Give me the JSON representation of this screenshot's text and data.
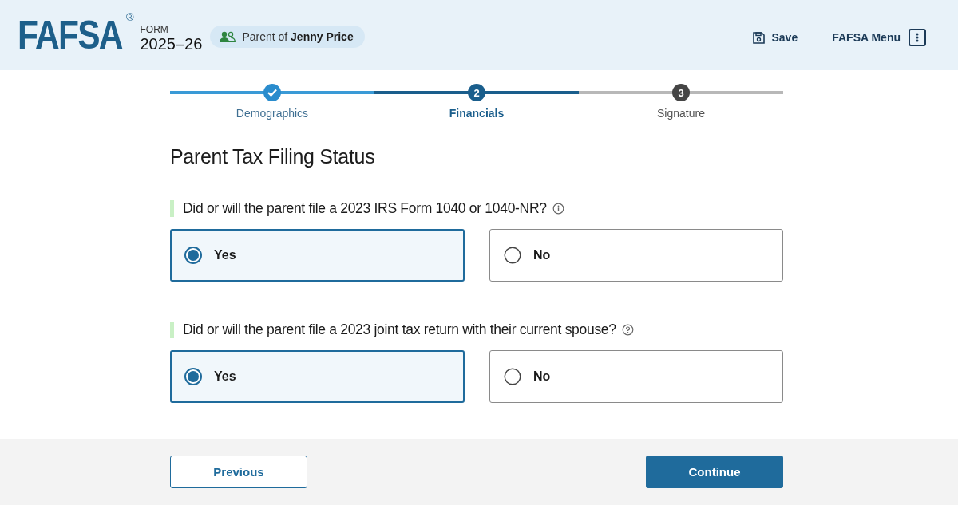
{
  "header": {
    "logo": "FAFSA",
    "logo_mark": "®",
    "form_label": "FORM",
    "form_year": "2025–26",
    "role_badge": "Parent of **Jenny Price**",
    "save": "Save",
    "menu": "FAFSA Menu"
  },
  "steps": [
    {
      "label": "Demographics",
      "kind": "complete"
    },
    {
      "label": "Financials",
      "kind": "current",
      "number": "2"
    },
    {
      "label": "Signature",
      "kind": "upcoming",
      "number": "3"
    }
  ],
  "page_title": "Parent Tax Filing Status",
  "questions": [
    {
      "text": "Did or will the parent file a 2023 IRS Form 1040 or 1040-NR?",
      "kind": "info",
      "options": [
        {
          "label": "Yes",
          "selected": true
        },
        {
          "label": "No",
          "selected": false
        }
      ]
    },
    {
      "text": "Did or will the parent file a 2023 joint tax return with their current spouse?",
      "kind": "help",
      "options": [
        {
          "label": "Yes",
          "selected": true
        },
        {
          "label": "No",
          "selected": false
        }
      ]
    }
  ],
  "footer": {
    "previous": "Previous",
    "continue": "Continue"
  }
}
